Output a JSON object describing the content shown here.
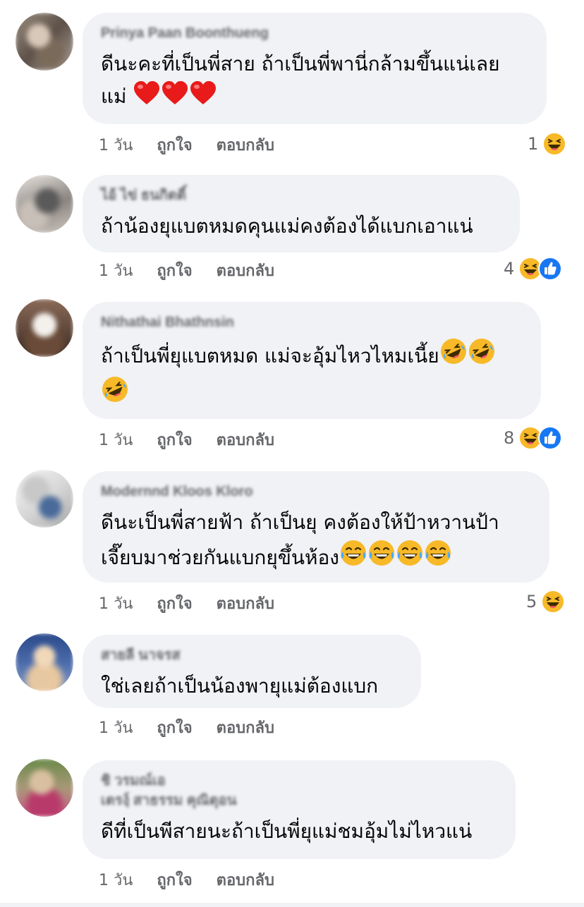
{
  "comments": [
    {
      "author": "Prinya Paan Boonthueng",
      "text_lines": [
        "ดีนะคะที่เป็นพี่สาย ถ้าเป็นพี่พานี่กล้ามขึ้นแน่เลย",
        "แม่ "
      ],
      "inline_emoji": [
        "heart",
        "heart",
        "heart"
      ],
      "time": "1 วัน",
      "like": "ถูกใจ",
      "reply": "ตอบกลับ",
      "reaction_count": "1",
      "reactions": [
        "haha"
      ]
    },
    {
      "author": "ไอ้ ไข่ ธนกิตติ์",
      "text_lines": [
        "ถ้าน้องยุแบตหมดคุนแม่คงต้องได้แบกเอาแน่"
      ],
      "time": "1 วัน",
      "like": "ถูกใจ",
      "reply": "ตอบกลับ",
      "reaction_count": "4",
      "reactions": [
        "haha",
        "like"
      ]
    },
    {
      "author": "Nithathai Bhathnsin",
      "text_lines": [
        "ถ้าเป็นพี่ยุแบตหมด แม่จะอุ้มไหวไหมเนี้ย",
        ""
      ],
      "inline_emoji": [
        "rofl",
        "rofl",
        "rofl"
      ],
      "time": "1 วัน",
      "like": "ถูกใจ",
      "reply": "ตอบกลับ",
      "reaction_count": "8",
      "reactions": [
        "haha",
        "like"
      ]
    },
    {
      "author": "Modernnd Kloos Kloro",
      "text_lines": [
        "ดีนะเป็นพี่สายฟ้า ถ้าเป็นยุ คงต้องให้ป้าหวานป้า",
        "เจี๊ยบมาช่วยกันแบกยุขึ้นห้อง"
      ],
      "inline_emoji": [
        "tears",
        "tears",
        "tears",
        "tears"
      ],
      "time": "1 วัน",
      "like": "ถูกใจ",
      "reply": "ตอบกลับ",
      "reaction_count": "5",
      "reactions": [
        "haha"
      ]
    },
    {
      "author": "สายลี นาจรส",
      "text_lines": [
        "ใช่เลยถ้าเป็นน้องพายุแม่ต้องแบก"
      ],
      "time": "1 วัน",
      "like": "ถูกใจ",
      "reply": "ตอบกลับ"
    },
    {
      "author": "ชิ วรมณ์เอ",
      "author_line2": "เตรงฺ์ สาธรรม คุณิตุอน",
      "text_lines": [
        "ดีที่เป็นพีสายนะถ้าเป็นพี่ยุแม่ชมอุ้มไม่ไหวแน่"
      ],
      "time": "1 วัน",
      "like": "ถูกใจ",
      "reply": "ตอบกลับ"
    }
  ],
  "colors": {
    "bubble": "#f0f2f5",
    "meta_text": "#65676b",
    "body_text": "#050505",
    "like_blue": "#1877f2",
    "haha_yellow": "#f7b928"
  }
}
